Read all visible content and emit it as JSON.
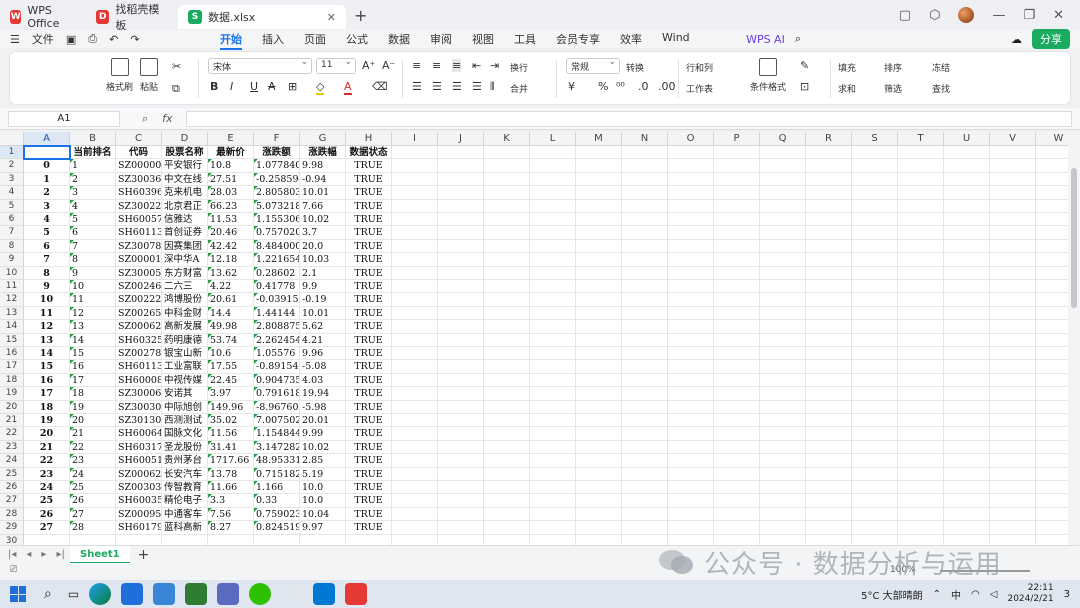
{
  "titlebar": {
    "tabs": [
      {
        "label": "WPS Office",
        "color": "#e53935",
        "glyph": "W"
      },
      {
        "label": "找稻壳模板",
        "color": "#e53935",
        "glyph": "D"
      },
      {
        "label": "数据.xlsx",
        "color": "#1aab60",
        "glyph": "S"
      }
    ]
  },
  "menubar": {
    "file_label": "文件",
    "tabs": [
      "开始",
      "插入",
      "页面",
      "公式",
      "数据",
      "审阅",
      "视图",
      "工具",
      "会员专享",
      "效率",
      "Wind"
    ],
    "active_tab": "开始",
    "wps_ai_label": "WPS AI",
    "share_label": "分享"
  },
  "ribbon": {
    "format_painter": "格式刷",
    "paste": "粘贴",
    "font_name": "宋体",
    "font_size": "11",
    "wrap": "换行",
    "merge": "合并",
    "number_format": "常规",
    "convert": "转换",
    "rows_cols": "行和列",
    "worksheet": "工作表",
    "conditional_format": "条件格式",
    "fill": "填充",
    "sort": "排序",
    "freeze": "冻结",
    "sum": "求和",
    "filter": "筛选",
    "find": "查找"
  },
  "formula_bar": {
    "name_box": "A1",
    "fx": "fx",
    "value": ""
  },
  "columns": [
    "A",
    "B",
    "C",
    "D",
    "E",
    "F",
    "G",
    "H",
    "I",
    "J",
    "K",
    "L",
    "M",
    "N",
    "O",
    "P",
    "Q",
    "R",
    "S",
    "T",
    "U",
    "V",
    "W"
  ],
  "header_row": [
    "",
    "当前排名",
    "代码",
    "股票名称",
    "最新价",
    "涨跌额",
    "涨跌幅",
    "数据状态"
  ],
  "rows": [
    [
      "0",
      "1",
      "SZ000001",
      "平安银行",
      "10.8",
      "1.077840",
      "9.98",
      "TRUE"
    ],
    [
      "1",
      "2",
      "SZ300364",
      "中文在线",
      "27.51",
      "-0.258594",
      "-0.94",
      "TRUE"
    ],
    [
      "2",
      "3",
      "SH603960",
      "克来机电",
      "28.03",
      "2.805803",
      "10.01",
      "TRUE"
    ],
    [
      "3",
      "4",
      "SZ300223",
      "北京君正",
      "66.23",
      "5.073218",
      "7.66",
      "TRUE"
    ],
    [
      "4",
      "5",
      "SH600571",
      "信雅达",
      "11.53",
      "1.155306",
      "10.02",
      "TRUE"
    ],
    [
      "5",
      "6",
      "SH601136",
      "首创证券",
      "20.46",
      "0.757020",
      "3.7",
      "TRUE"
    ],
    [
      "6",
      "7",
      "SZ300781",
      "因赛集团",
      "42.42",
      "8.484000",
      "20.0",
      "TRUE"
    ],
    [
      "7",
      "8",
      "SZ000017",
      "深中华A",
      "12.18",
      "1.221654",
      "10.03",
      "TRUE"
    ],
    [
      "8",
      "9",
      "SZ300059",
      "东方财富",
      "13.62",
      "0.28602",
      "2.1",
      "TRUE"
    ],
    [
      "9",
      "10",
      "SZ002467",
      "二六三",
      "4.22",
      "0.41778",
      "9.9",
      "TRUE"
    ],
    [
      "10",
      "11",
      "SZ002229",
      "鸿博股份",
      "20.61",
      "-0.039159",
      "-0.19",
      "TRUE"
    ],
    [
      "11",
      "12",
      "SZ002657",
      "中科金财",
      "14.4",
      "1.44144",
      "10.01",
      "TRUE"
    ],
    [
      "12",
      "13",
      "SZ000628",
      "高新发展",
      "49.98",
      "2.808875",
      "5.62",
      "TRUE"
    ],
    [
      "13",
      "14",
      "SH603259",
      "药明康德",
      "53.74",
      "2.262454",
      "4.21",
      "TRUE"
    ],
    [
      "14",
      "15",
      "SZ002786",
      "银宝山新",
      "10.6",
      "1.05576",
      "9.96",
      "TRUE"
    ],
    [
      "15",
      "16",
      "SH601138",
      "工业富联",
      "17.55",
      "-0.891540",
      "-5.08",
      "TRUE"
    ],
    [
      "16",
      "17",
      "SH600088",
      "中视传媒",
      "22.45",
      "0.904735",
      "4.03",
      "TRUE"
    ],
    [
      "17",
      "18",
      "SZ300067",
      "安诺其",
      "3.97",
      "0.791618",
      "19.94",
      "TRUE"
    ],
    [
      "18",
      "19",
      "SZ300308",
      "中际旭创",
      "149.96",
      "-8.967608",
      "-5.98",
      "TRUE"
    ],
    [
      "19",
      "20",
      "SZ301306",
      "西测测试",
      "35.02",
      "7.007502",
      "20.01",
      "TRUE"
    ],
    [
      "20",
      "21",
      "SH600640",
      "国脉文化",
      "11.56",
      "1.154844",
      "9.99",
      "TRUE"
    ],
    [
      "21",
      "22",
      "SH603178",
      "圣龙股份",
      "31.41",
      "3.147282",
      "10.02",
      "TRUE"
    ],
    [
      "22",
      "23",
      "SH600519",
      "贵州茅台",
      "1717.66",
      "48.95331",
      "2.85",
      "TRUE"
    ],
    [
      "23",
      "24",
      "SZ000625",
      "长安汽车",
      "13.78",
      "0.715182",
      "5.19",
      "TRUE"
    ],
    [
      "24",
      "25",
      "SZ003032",
      "传智教育",
      "11.66",
      "1.166",
      "10.0",
      "TRUE"
    ],
    [
      "25",
      "26",
      "SH600355",
      "精伦电子",
      "3.3",
      "0.33",
      "10.0",
      "TRUE"
    ],
    [
      "26",
      "27",
      "SZ000957",
      "中通客车",
      "7.56",
      "0.759023",
      "10.04",
      "TRUE"
    ],
    [
      "27",
      "28",
      "SH601798",
      "蓝科高新",
      "8.27",
      "0.824519",
      "9.97",
      "TRUE"
    ]
  ],
  "sheet_tabs": [
    "Sheet1"
  ],
  "statusbar": {
    "zoom": "100%"
  },
  "watermark": "公众号 · 数据分析与运用",
  "taskbar": {
    "weather": "5°C 大部晴朗",
    "ime": "中",
    "time": "22:11",
    "date": "2024/2/21",
    "notifications": "3"
  }
}
